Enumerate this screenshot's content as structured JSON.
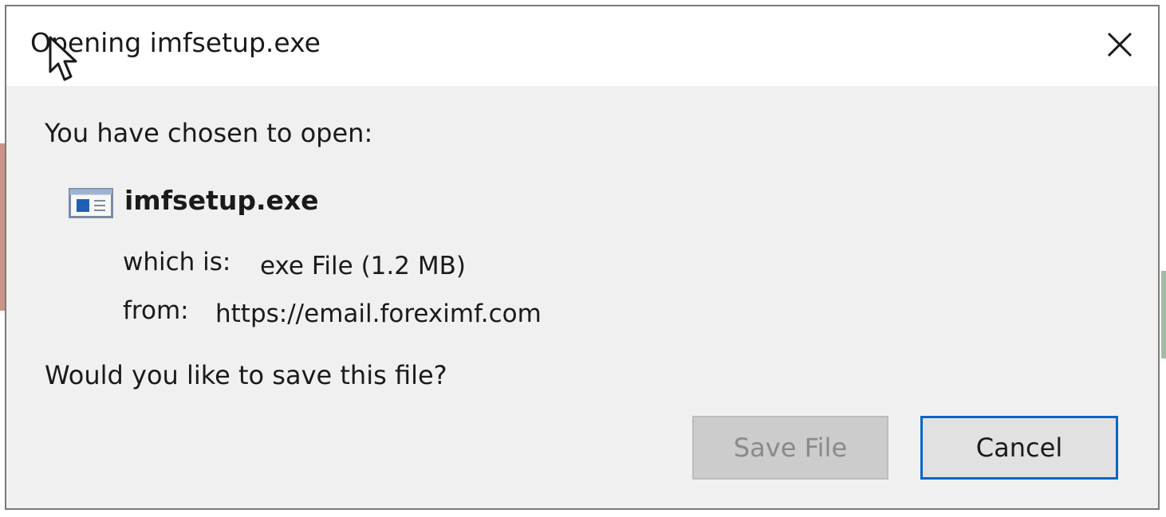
{
  "dialog": {
    "title": "Opening imfsetup.exe",
    "close_icon": "close-icon",
    "prompt": "You have chosen to open:",
    "file": {
      "icon": "exe-file-icon",
      "name": "imfsetup.exe"
    },
    "type_label": "which is:",
    "type_value": "exe File (1.2 MB)",
    "from_label": "from:",
    "from_value": "https://email.foreximf.com",
    "question": "Would you like to save this file?",
    "buttons": {
      "save_label": "Save File",
      "save_enabled": false,
      "cancel_label": "Cancel"
    }
  },
  "colors": {
    "dialog_bg": "#f0f0f0",
    "titlebar_bg": "#ffffff",
    "focus_border": "#0a64c8",
    "disabled_text": "#8a8a8a"
  }
}
